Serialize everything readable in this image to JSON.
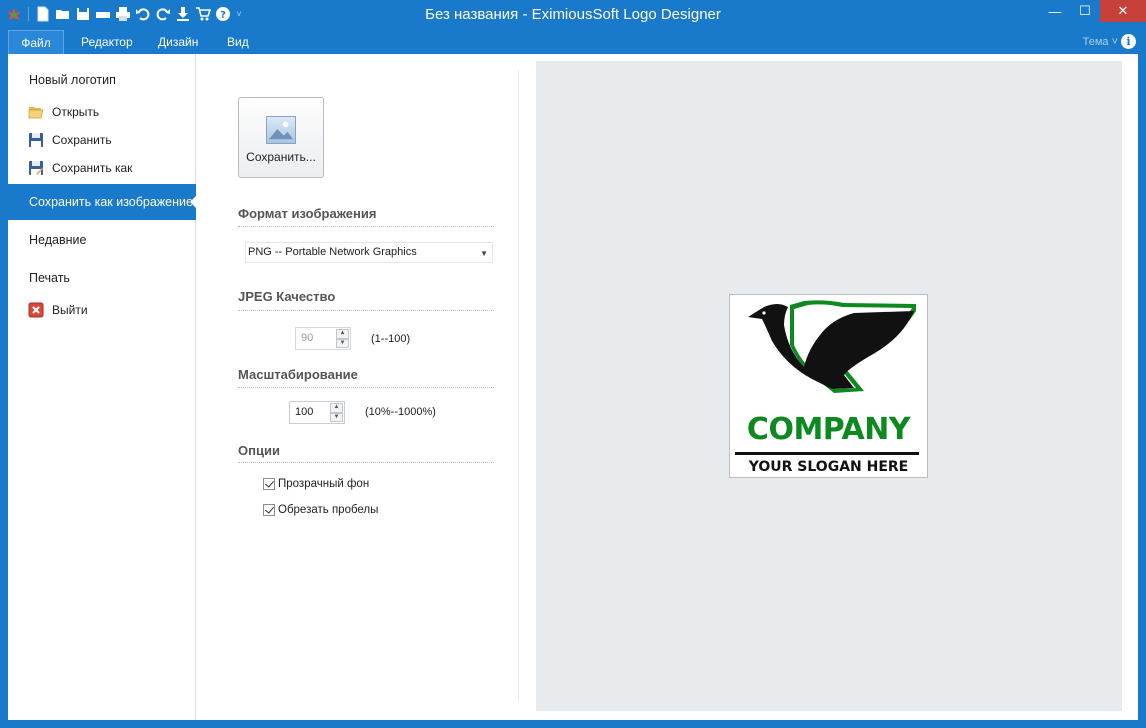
{
  "window": {
    "title": "Без названия - EximiousSoft Logo Designer",
    "minimize": "—",
    "maximize": "☐",
    "close": "✕"
  },
  "quick_access": [
    "app-logo-icon",
    "new-icon",
    "open-icon",
    "save-icon",
    "scanner-icon",
    "print-icon",
    "undo-icon",
    "redo-icon",
    "download-icon",
    "cart-icon",
    "help-icon"
  ],
  "ribbon": {
    "tabs": [
      "Файл",
      "Редактор",
      "Дизайн",
      "Вид"
    ],
    "active_tab": "Файл",
    "theme": "Тема ˅",
    "info": "i"
  },
  "nav": {
    "new_logo": "Новый логотип",
    "open": "Открыть",
    "save": "Сохранить",
    "save_as": "Сохранить как",
    "save_as_image": "Сохранить как изображение",
    "recent": "Недавние",
    "print": "Печать",
    "exit": "Выйти"
  },
  "panel": {
    "save_button": "Сохранить...",
    "format_heading": "Формат изображения",
    "format_value": "PNG  -- Portable Network Graphics",
    "jpeg_heading": "JPEG Качество",
    "jpeg_value": "90",
    "jpeg_range": "(1--100)",
    "scale_heading": "Масштабирование",
    "scale_value": "100",
    "scale_range": "(10%--1000%)",
    "options_heading": "Опции",
    "opt_transparent": "Прозрачный фон",
    "opt_trim": "Обрезать пробелы",
    "opt_transparent_checked": true,
    "opt_trim_checked": true
  },
  "preview": {
    "company": "COMPANY",
    "slogan": "YOUR SLOGAN HERE"
  },
  "colors": {
    "accent": "#1979ca",
    "logo_green": "#0c8a1f",
    "close_red": "#c7413a",
    "preview_bg": "#e8ebee"
  }
}
